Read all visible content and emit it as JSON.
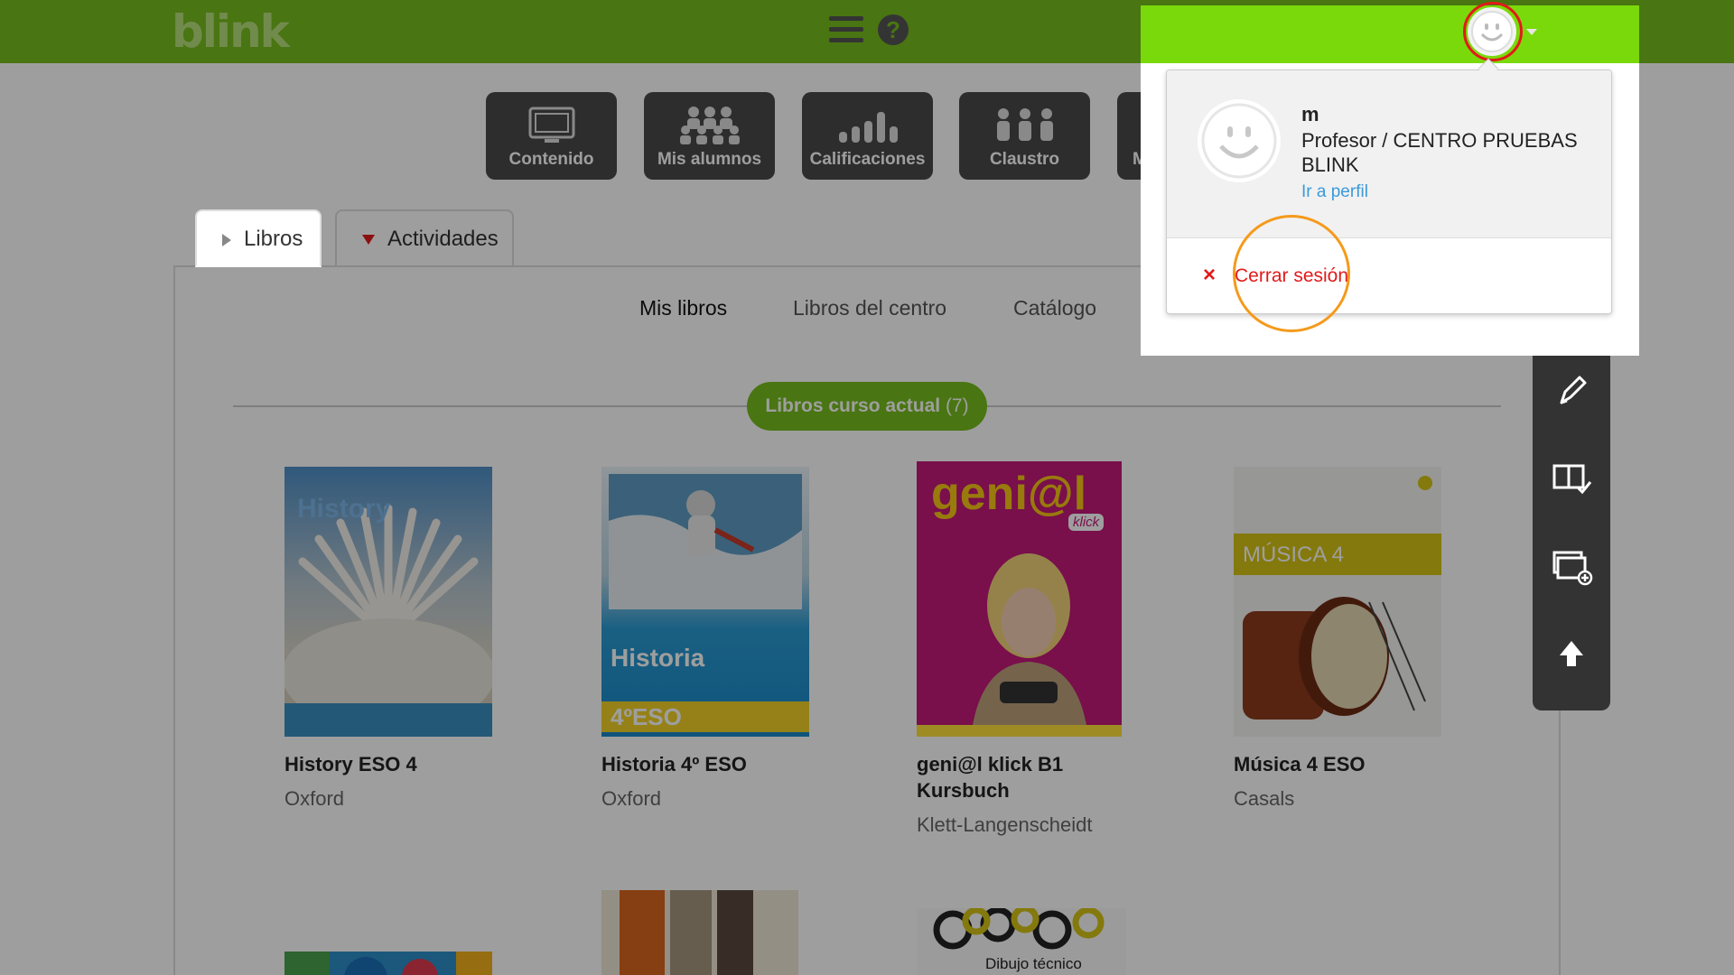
{
  "app": {
    "logo": "blink"
  },
  "colors": {
    "brand_green": "#76bd1d",
    "accent_green": "#7ad90a",
    "logout_red": "#e21a1a",
    "highlight_orange": "#f59a1b",
    "link_blue": "#3a9ad9"
  },
  "header": {
    "menu_icon": "hamburger-icon",
    "help_icon": "help-icon",
    "help_glyph": "?"
  },
  "tools": [
    {
      "label": "Contenido",
      "icon": "monitor-icon"
    },
    {
      "label": "Mis alumnos",
      "icon": "students-icon"
    },
    {
      "label": "Calificaciones",
      "icon": "bar-chart-icon"
    },
    {
      "label": "Claustro",
      "icon": "teachers-icon"
    },
    {
      "label": "Mis r",
      "icon": "document-icon"
    }
  ],
  "tabs": [
    {
      "label": "Libros"
    },
    {
      "label": "Actividades"
    }
  ],
  "subnav": [
    "Mis libros",
    "Libros del centro",
    "Catálogo"
  ],
  "section": {
    "label": "Libros curso actual",
    "count": "(7)"
  },
  "books": [
    {
      "title": "History ESO 4",
      "publisher": "Oxford",
      "cover_text": "History"
    },
    {
      "title": "Historia 4º ESO",
      "publisher": "Oxford",
      "cover_text": "Historia",
      "cover_sub": "4ºESO"
    },
    {
      "title": "geni@l klick B1 Kursbuch",
      "publisher": "Klett-Langenscheidt",
      "cover_text": "geni@l",
      "cover_sub": "klick"
    },
    {
      "title": "Música 4 ESO",
      "publisher": "Casals",
      "cover_text": "MÚSICA 4"
    }
  ],
  "more_books": [
    {
      "cover_text": ""
    },
    {
      "cover_text": ""
    },
    {
      "cover_text": "Dibujo técnico"
    }
  ],
  "sidebar": [
    "pencil-icon",
    "book-check-icon",
    "add-window-icon",
    "upload-arrow-icon"
  ],
  "user_menu": {
    "name": "m",
    "role": "Profesor / CENTRO PRUEBAS BLINK",
    "profile_link": "Ir a perfil",
    "logout_icon": "×",
    "logout": "Cerrar sesión"
  }
}
